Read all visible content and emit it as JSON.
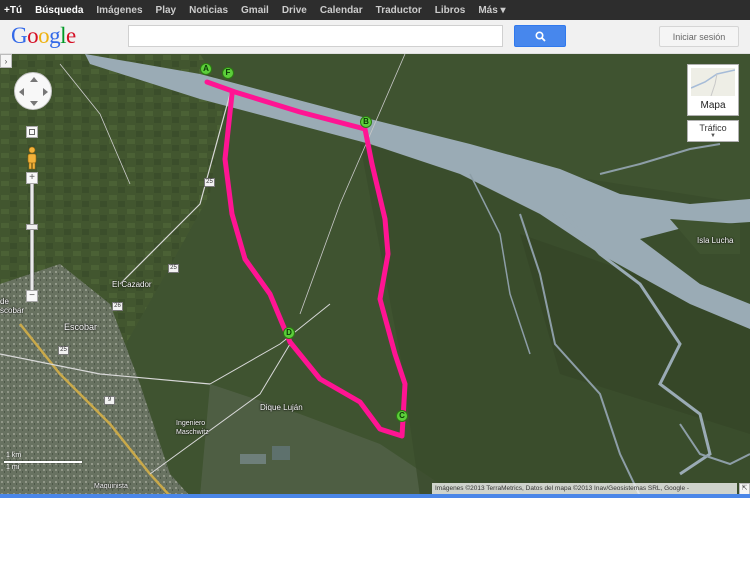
{
  "topbar": {
    "links": [
      "+Tú",
      "Búsqueda",
      "Imágenes",
      "Play",
      "Noticias",
      "Gmail",
      "Drive",
      "Calendar",
      "Traductor",
      "Libros",
      "Más ▾"
    ]
  },
  "header": {
    "logo": "Google",
    "logo_colors": [
      "#3369e8",
      "#d50f25",
      "#eeb211",
      "#3369e8",
      "#009925",
      "#d50f25"
    ],
    "search_value": "",
    "signin_label": "Iniciar sesión"
  },
  "map": {
    "type_label": "Mapa",
    "traffic_label": "Tráfico",
    "route_color": "#ff1493",
    "water_color": "#9aabb5",
    "labels": {
      "el_cazador": "El Cazador",
      "escobar": "Escobar",
      "loma_verde": "de\nscobar",
      "isla_lucha": "Isla Lucha",
      "dique_lujan": "Dique Luján",
      "ingeniero": "Ingeniero",
      "maschwitz": "Maschwitz",
      "matheu": "Maquinista"
    },
    "road_shields": [
      "25",
      "25",
      "25",
      "26",
      "9"
    ],
    "markers": [
      "A",
      "F",
      "B",
      "D",
      "C"
    ],
    "scale": {
      "top": "1 km",
      "bottom": "1 mi"
    },
    "attribution": "Imágenes ©2013 TerraMetrics, Datos del mapa ©2013 Inav/Geosistemas SRL, Google -"
  }
}
